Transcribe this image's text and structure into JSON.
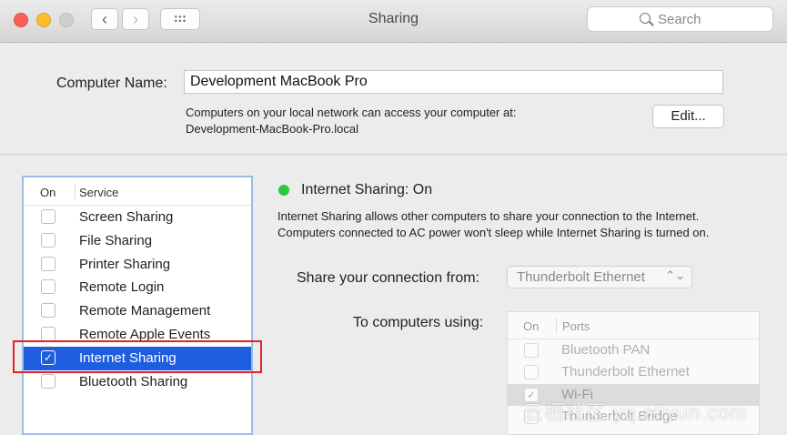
{
  "window": {
    "title": "Sharing",
    "nav_back": "‹",
    "nav_forward": "›",
    "search_placeholder": "Search"
  },
  "computer_name": {
    "label": "Computer Name:",
    "value": "Development MacBook Pro",
    "description_line1": "Computers on your local network can access your computer at:",
    "description_line2": "Development-MacBook-Pro.local",
    "edit_label": "Edit..."
  },
  "services": {
    "header_on": "On",
    "header_service": "Service",
    "items": [
      {
        "label": "Screen Sharing",
        "checked": false
      },
      {
        "label": "File Sharing",
        "checked": false
      },
      {
        "label": "Printer Sharing",
        "checked": false
      },
      {
        "label": "Remote Login",
        "checked": false
      },
      {
        "label": "Remote Management",
        "checked": false
      },
      {
        "label": "Remote Apple Events",
        "checked": false
      },
      {
        "label": "Internet Sharing",
        "checked": true,
        "selected": true
      },
      {
        "label": "Bluetooth Sharing",
        "checked": false
      }
    ]
  },
  "detail": {
    "status": "Internet Sharing: On",
    "status_color": "#2bc840",
    "description": "Internet Sharing allows other computers to share your connection to the Internet. Computers connected to AC power won't sleep while Internet Sharing is turned on.",
    "share_from_label": "Share your connection from:",
    "share_from_value": "Thunderbolt Ethernet",
    "to_computers_label": "To computers using:",
    "ports_header_on": "On",
    "ports_header_ports": "Ports",
    "ports": [
      {
        "label": "Bluetooth PAN",
        "checked": false
      },
      {
        "label": "Thunderbolt Ethernet",
        "checked": false
      },
      {
        "label": "Wi-Fi",
        "checked": true,
        "selected": true
      },
      {
        "label": "Thunderbolt Bridge",
        "checked": false
      }
    ]
  },
  "watermark": "云栖社区 yq.aliyun.com",
  "colors": {
    "selection": "#1e5ede",
    "highlight_box": "#e0212b"
  }
}
